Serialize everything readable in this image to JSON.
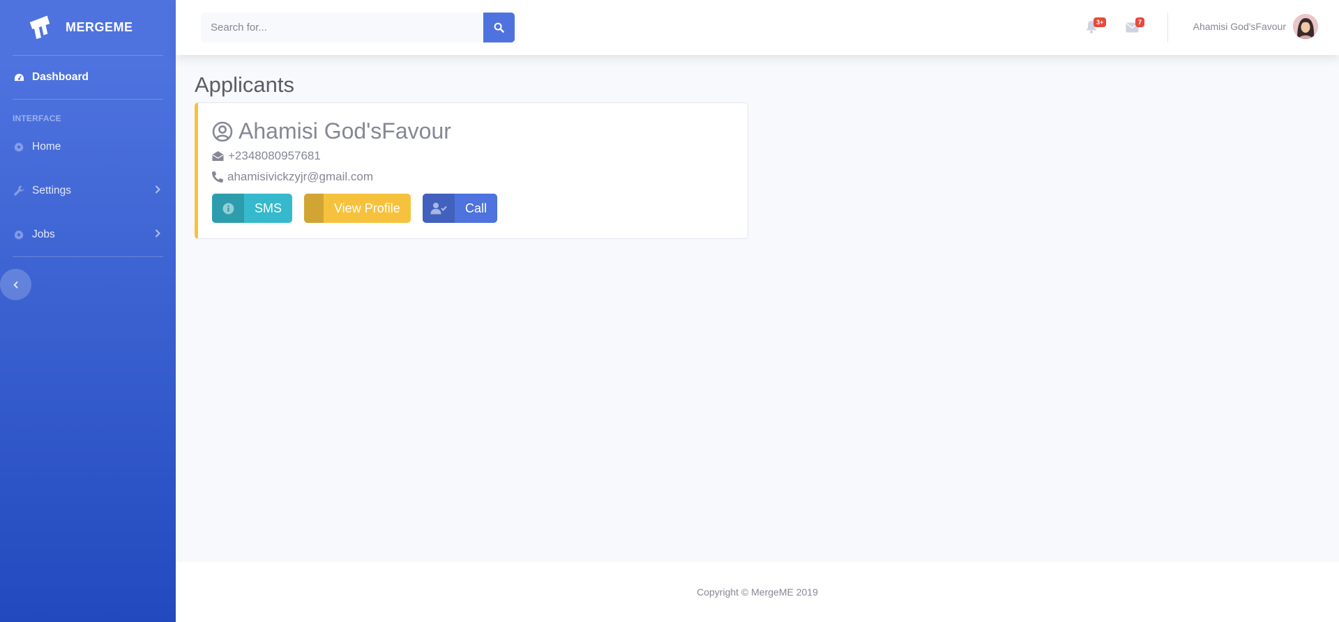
{
  "brand": {
    "name": "MERGEME"
  },
  "sidebar": {
    "dashboard": {
      "label": "Dashboard"
    },
    "heading": "INTERFACE",
    "items": [
      {
        "label": "Home",
        "icon": "gear-icon"
      },
      {
        "label": "Settings",
        "icon": "wrench-icon"
      },
      {
        "label": "Jobs",
        "icon": "gear-icon"
      }
    ]
  },
  "topbar": {
    "search_placeholder": "Search for...",
    "alerts_badge": "3+",
    "messages_badge": "7",
    "user_name": "Ahamisi God'sFavour"
  },
  "main": {
    "title": "Applicants",
    "applicant": {
      "name": "Ahamisi God'sFavour",
      "phone": "+2348080957681",
      "email": "ahamisivickzyjr@gmail.com"
    },
    "buttons": {
      "sms": "SMS",
      "view_profile": "View Profile",
      "call": "Call"
    }
  },
  "footer": {
    "copyright": "Copyright © MergeME 2019"
  },
  "colors": {
    "primary": "#4e73df",
    "warning": "#f6c23e",
    "info": "#36b9cc",
    "danger": "#e74a3b"
  }
}
